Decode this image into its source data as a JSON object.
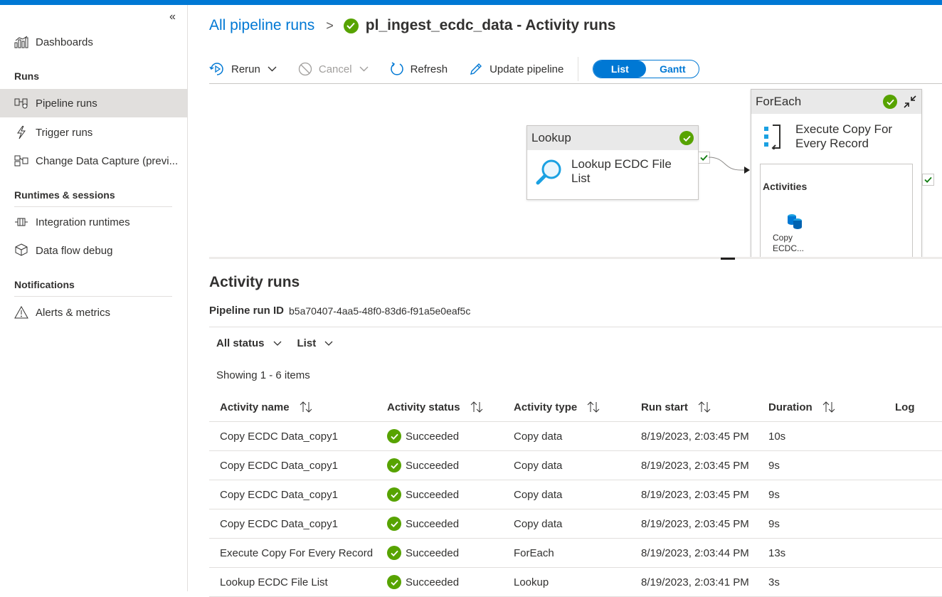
{
  "sidebar": {
    "items": [
      {
        "label": "Dashboards"
      },
      {
        "label": "Pipeline runs"
      },
      {
        "label": "Trigger runs"
      },
      {
        "label": "Change Data Capture (previ..."
      },
      {
        "label": "Integration runtimes"
      },
      {
        "label": "Data flow debug"
      },
      {
        "label": "Alerts & metrics"
      }
    ],
    "sections": {
      "runs": "Runs",
      "runtimes": "Runtimes & sessions",
      "notifications": "Notifications"
    }
  },
  "breadcrumb": {
    "parent": "All pipeline runs",
    "separator": ">",
    "title": "pl_ingest_ecdc_data - Activity runs"
  },
  "toolbar": {
    "rerun": "Rerun",
    "cancel": "Cancel",
    "refresh": "Refresh",
    "update_pipeline": "Update pipeline",
    "view_list": "List",
    "view_gantt": "Gantt"
  },
  "canvas": {
    "lookup": {
      "type": "Lookup",
      "name": "Lookup ECDC File List"
    },
    "foreach": {
      "type": "ForEach",
      "name": "Execute Copy For Every Record",
      "activities_label": "Activities",
      "child_name": "Copy ECDC..."
    }
  },
  "activity_runs": {
    "title": "Activity runs",
    "run_id_label": "Pipeline run ID",
    "run_id": "b5a70407-4aa5-48f0-83d6-f91a5e0eaf5c",
    "filter_status": "All status",
    "filter_view": "List",
    "showing": "Showing 1 - 6 items",
    "columns": {
      "name": "Activity name",
      "status": "Activity status",
      "type": "Activity type",
      "start": "Run start",
      "duration": "Duration",
      "log": "Log"
    },
    "rows": [
      {
        "name": "Copy ECDC Data_copy1",
        "status": "Succeeded",
        "type": "Copy data",
        "start": "8/19/2023, 2:03:45 PM",
        "duration": "10s"
      },
      {
        "name": "Copy ECDC Data_copy1",
        "status": "Succeeded",
        "type": "Copy data",
        "start": "8/19/2023, 2:03:45 PM",
        "duration": "9s"
      },
      {
        "name": "Copy ECDC Data_copy1",
        "status": "Succeeded",
        "type": "Copy data",
        "start": "8/19/2023, 2:03:45 PM",
        "duration": "9s"
      },
      {
        "name": "Copy ECDC Data_copy1",
        "status": "Succeeded",
        "type": "Copy data",
        "start": "8/19/2023, 2:03:45 PM",
        "duration": "9s"
      },
      {
        "name": "Execute Copy For Every Record",
        "status": "Succeeded",
        "type": "ForEach",
        "start": "8/19/2023, 2:03:44 PM",
        "duration": "13s"
      },
      {
        "name": "Lookup ECDC File List",
        "status": "Succeeded",
        "type": "Lookup",
        "start": "8/19/2023, 2:03:41 PM",
        "duration": "3s"
      }
    ]
  },
  "colors": {
    "accent": "#0078d4",
    "success": "#57a300",
    "selected_bg": "#e1dfdd"
  }
}
